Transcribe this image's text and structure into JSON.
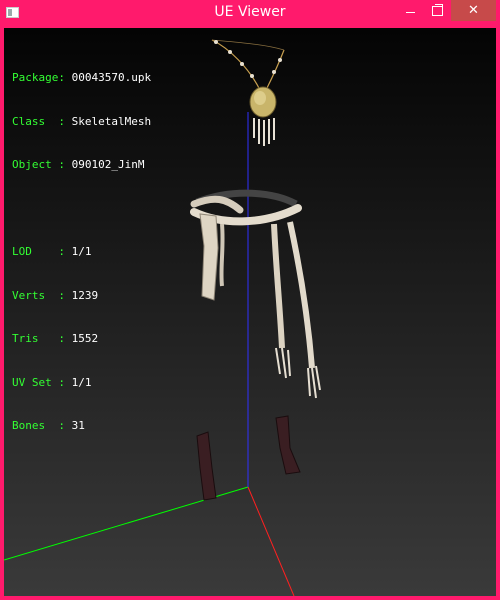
{
  "window": {
    "title": "UE Viewer",
    "controls": [
      "minimize",
      "maximize",
      "close"
    ]
  },
  "info": {
    "rows": [
      {
        "key": "Package: ",
        "value": "00043570.upk"
      },
      {
        "key": "Class  : ",
        "value": "SkeletalMesh"
      },
      {
        "key": "Object : ",
        "value": "090102_JinM"
      }
    ],
    "stats": [
      {
        "key": "LOD    : ",
        "value": "1/1"
      },
      {
        "key": "Verts  : ",
        "value": "1239"
      },
      {
        "key": "Tris   : ",
        "value": "1552"
      },
      {
        "key": "UV Set : ",
        "value": "1/1"
      },
      {
        "key": "Bones  : ",
        "value": "31"
      }
    ]
  },
  "colors": {
    "frame": "#ff1a6c",
    "axis_x": "#00ff00",
    "axis_y": "#ff2020",
    "axis_z": "#2020ff",
    "info_key": "#33ff33",
    "info_value": "#ffffff",
    "mesh": "#d9d0c0"
  }
}
